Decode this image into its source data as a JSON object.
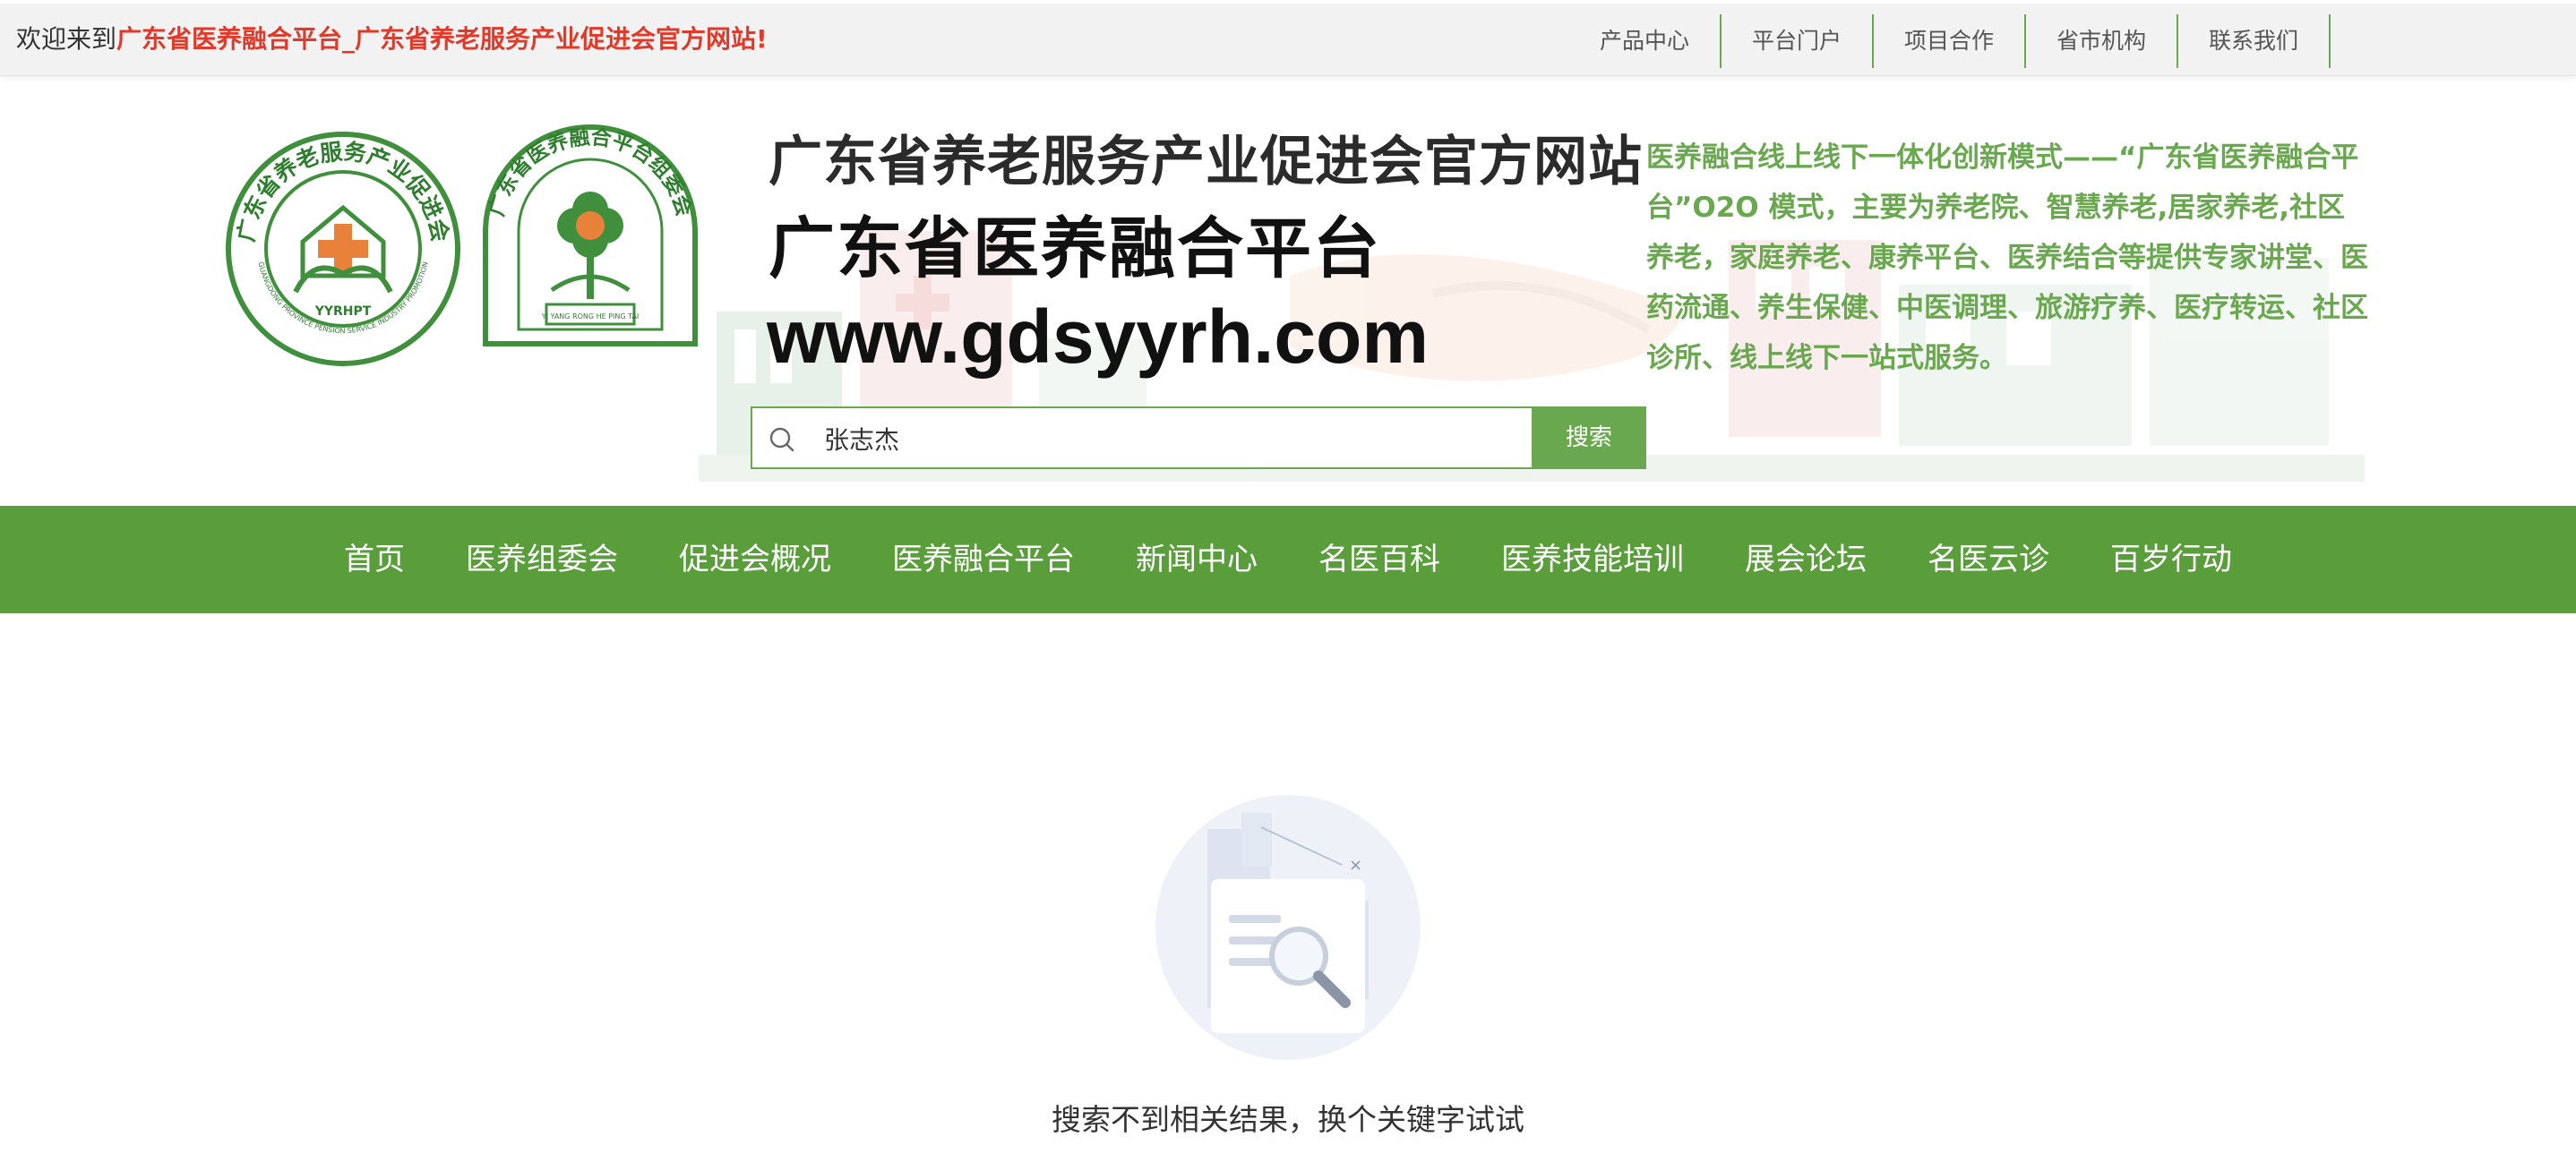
{
  "topbar": {
    "welcome_prefix": "欢迎来到",
    "welcome_highlight": "广东省医养融合平台_广东省养老服务产业促进会官方网站!",
    "links": [
      "产品中心",
      "平台门户",
      "项目合作",
      "省市机构",
      "联系我们"
    ]
  },
  "header": {
    "title_line1": "广东省养老服务产业促进会官方网站",
    "title_line2": "广东省医养融合平台",
    "domain": "www.gdsyyrh.com",
    "intro": "医养融合线上线下一体化创新模式——“广东省医养融合平台”O2O 模式，主要为养老院、智慧养老,居家养老,社区养老，家庭养老、康养平台、医养结合等提供专家讲堂、医药流通、养生保健、中医调理、旅游疗养、医疗转运、社区诊所、线上线下一站式服务。",
    "logo1_text_top": "广东省养老服务产业促进会",
    "logo1_text_bottom": "GUANGDONG PROVINCE PENSION SERVICE INDUSTRY PROMOTION",
    "logo1_abbr": "YYRHPT",
    "logo2_text_top": "广东省医养融合平台组委会",
    "logo2_text_bottom": "YI YANG RONG HE PING TAI"
  },
  "search": {
    "value": "张志杰",
    "button_label": "搜索"
  },
  "nav": {
    "items": [
      "首页",
      "医养组委会",
      "促进会概况",
      "医养融合平台",
      "新闻中心",
      "名医百科",
      "医养技能培训",
      "展会论坛",
      "名医云诊",
      "百岁行动"
    ]
  },
  "empty_state": {
    "message": "搜索不到相关结果，换个关键字试试"
  },
  "colors": {
    "brand_green": "#5a9e3c",
    "accent_green": "#6aa84f",
    "highlight_red": "#e03a2a"
  },
  "icons": {
    "search": "search-icon",
    "empty": "no-results-illustration"
  }
}
